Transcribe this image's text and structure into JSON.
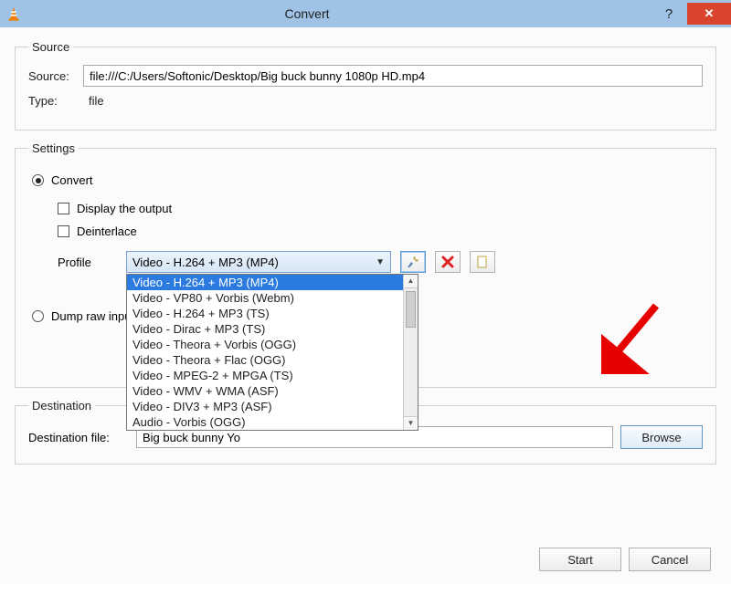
{
  "window": {
    "title": "Convert",
    "close_text": "✕",
    "help_text": "?"
  },
  "source": {
    "legend": "Source",
    "source_label": "Source:",
    "source_value": "file:///C:/Users/Softonic/Desktop/Big buck bunny 1080p HD.mp4",
    "type_label": "Type:",
    "type_value": "file"
  },
  "settings": {
    "legend": "Settings",
    "convert_label": "Convert",
    "display_output_label": "Display the output",
    "deinterlace_label": "Deinterlace",
    "profile_label": "Profile",
    "dump_label": "Dump raw input",
    "selected_profile": "Video - H.264 + MP3 (MP4)",
    "profile_options": [
      "Video - H.264 + MP3 (MP4)",
      "Video - VP80 + Vorbis (Webm)",
      "Video - H.264 + MP3 (TS)",
      "Video - Dirac + MP3 (TS)",
      "Video - Theora + Vorbis (OGG)",
      "Video - Theora + Flac (OGG)",
      "Video - MPEG-2 + MPGA (TS)",
      "Video - WMV + WMA (ASF)",
      "Video - DIV3 + MP3 (ASF)",
      "Audio - Vorbis (OGG)"
    ]
  },
  "destination": {
    "legend": "Destination",
    "file_label": "Destination file:",
    "file_value": "Big buck bunny Yo",
    "browse_label": "Browse"
  },
  "footer": {
    "start_label": "Start",
    "cancel_label": "Cancel"
  }
}
